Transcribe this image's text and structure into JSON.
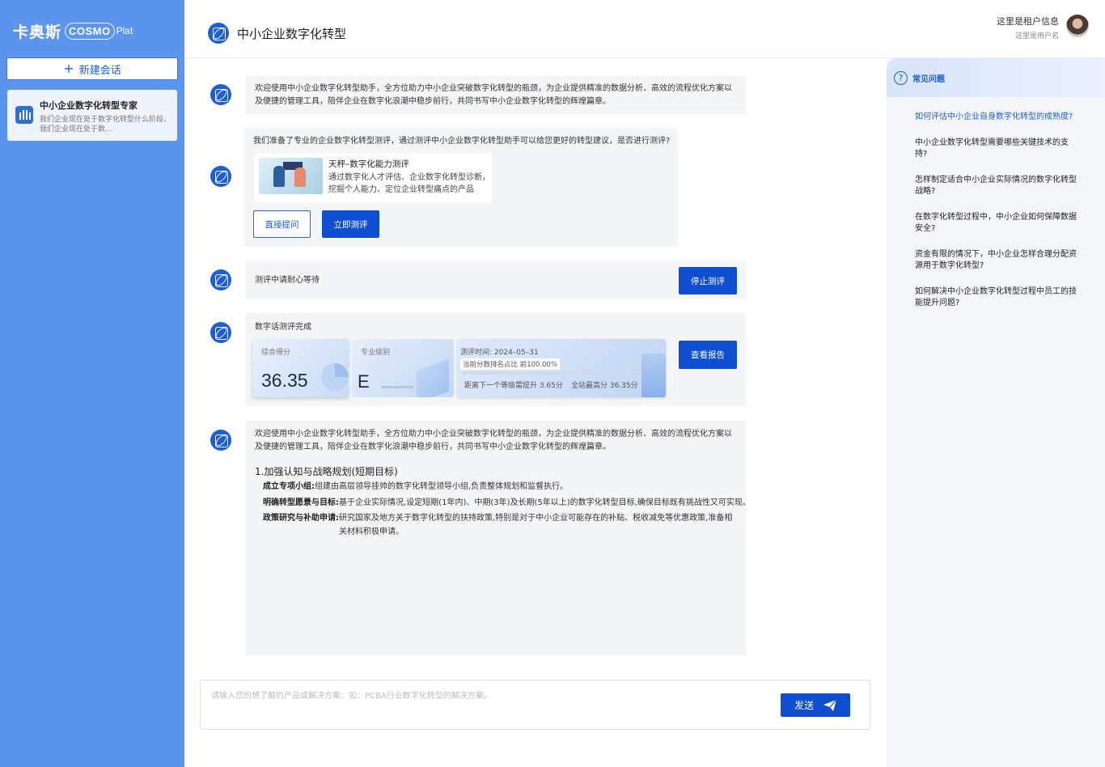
{
  "brand": {
    "name_cn": "卡奥斯",
    "logo_main": "COSMO",
    "logo_sub": "Plat"
  },
  "sidebar": {
    "new_chat_label": "新建会话",
    "sessions": [
      {
        "title": "中小企业数字化转型专家",
        "desc": "我们企业现在处于数字化转型什么阶段，我们企业现在处于数..."
      }
    ]
  },
  "header": {
    "title": "中小企业数字化转型"
  },
  "user": {
    "tenant": "这里是租户信息",
    "name": "这里是用户名"
  },
  "chat": {
    "welcome": "欢迎使用中小企业数字化转型助手，全方位助力中小企业突破数字化转型的瓶颈，为企业提供精准的数据分析、高效的流程优化方案以及便捷的管理工具，陪伴企业在数字化浪潮中稳步前行，共同书写中小企业数字化转型的辉煌篇章。",
    "assessment_prompt": "我们准备了专业的企业数字化转型测评，通过测评中小企业数字化转型助手可以给您更好的转型建议，是否进行测评?",
    "product_card": {
      "title": "天秤–数字化能力测评",
      "desc": "通过数字化人才评估、企业数字化转型诊断，挖掘个人能力、定位企业转型痛点的产品"
    },
    "btn_ask": "直接提问",
    "btn_assess": "立即测评",
    "waiting_text": "测评中请耐心等待",
    "btn_stop": "停止测评",
    "result": {
      "title": "数字话测评完成",
      "score_label": "综合得分",
      "score": "36.35",
      "level_label": "专业级别",
      "level": "E",
      "date": "测评时间:  2024–05–31",
      "rank": "当前分数排名占比 前100.00%",
      "rank_percent": 100,
      "next_level": "距离下一个等级需提升 3.65分",
      "top_score": "全站最高分 36.35分",
      "btn_report": "查看报告"
    },
    "answer": {
      "intro": "欢迎使用中小企业数字化转型助手，全方位助力中小企业突破数字化转型的瓶颈，为企业提供精准的数据分析、高效的流程优化方案以及便捷的管理工具，陪伴企业在数字化浪潮中稳步前行，共同书写中小企业数字化转型的辉煌篇章。",
      "section_title": "1.加强认知与战略规划(短期目标)",
      "bullets": [
        {
          "label": "成立专项小组:",
          "text": "组建由高层领导挂帅的数字化转型领导小组,负责整体规划和监督执行。"
        },
        {
          "label": "明确转型愿景与目标:",
          "text": "基于企业实际情况,设定短期(1年内)、中期(3年)及长期(5年以上)的数字化转型目标,确保目标既有挑战性又可实现。"
        },
        {
          "label": "政策研究与补助申请:",
          "text": "研究国家及地方关于数字化转型的扶持政策,特别是对于中小企业可能存在的补贴、税收减免等优惠政策,准备相关材料积极申请。"
        }
      ]
    }
  },
  "composer": {
    "placeholder": "请输入您的想了解的产品或解决方案。如：PCBA行业数字化转型的解决方案。",
    "send_label": "发送"
  },
  "faq": {
    "title": "常见问题",
    "items": [
      "如何评估中小企业自身数字化转型的成熟度?",
      "中小企业数字化转型需要哪些关键技术的支持?",
      "怎样制定适合中小企业实际情况的数字化转型战略?",
      "在数字化转型过程中，中小企业如何保障数据安全?",
      "资金有限的情况下，中小企业怎样合理分配资源用于数字化转型?",
      "如何解决中小企业数字化转型过程中员工的技能提升问题?"
    ]
  },
  "colors": {
    "sidebar": "#5b95ee",
    "primary": "#0d4fd0",
    "link": "#1a5fd8"
  },
  "icons": {
    "bot": "atom-robot-icon",
    "send": "paper-plane-icon",
    "help": "question-circle-icon",
    "session": "robot-app-icon"
  }
}
